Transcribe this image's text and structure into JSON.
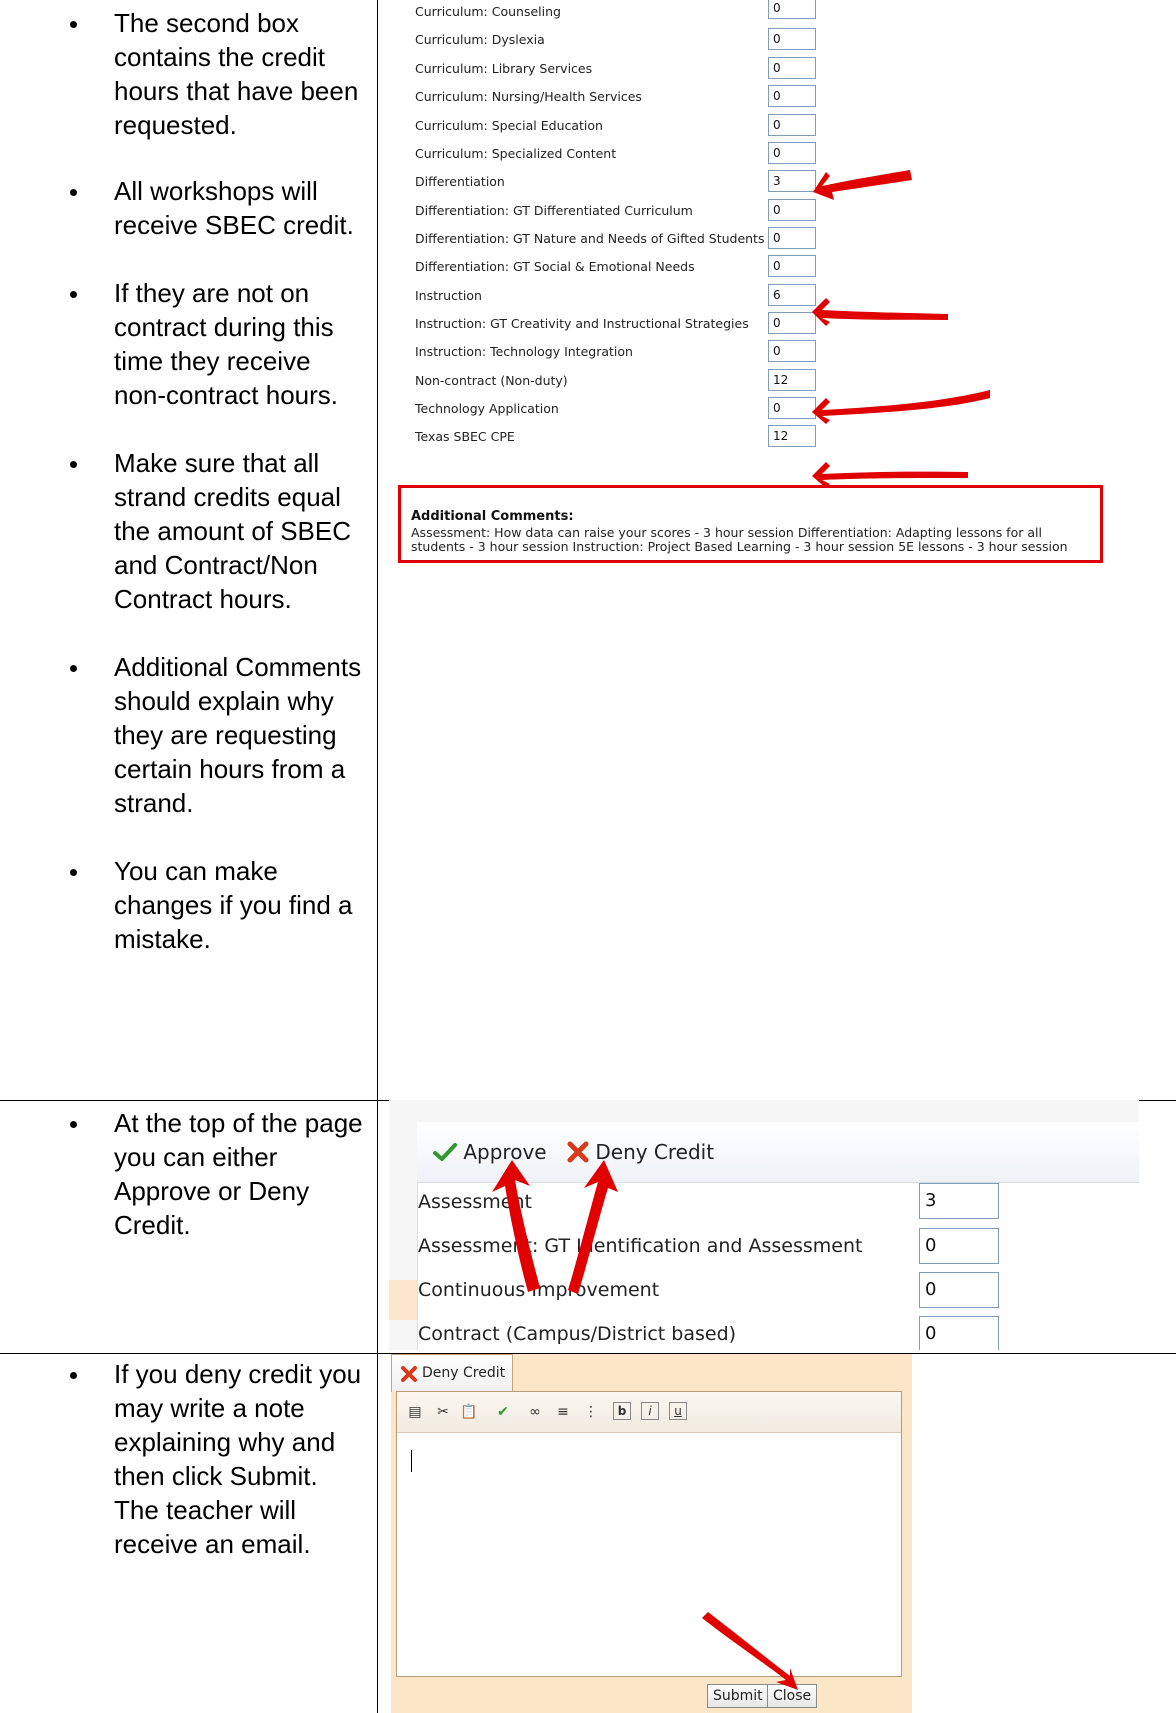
{
  "instructions": {
    "section1": [
      "The second box contains the credit hours that have been requested.",
      "All workshops will receive SBEC credit.",
      "If they are not on contract during this time they receive non-contract hours.",
      "Make sure that all strand credits equal the amount of SBEC and Contract/Non Contract hours.",
      "Additional Comments should explain why they are requesting certain hours from a strand.",
      "You can make changes if you find a mistake."
    ],
    "section2": [
      "At the top of the page you can either Approve or Deny Credit."
    ],
    "section3": [
      "If you deny credit you may write a note explaining why and then click Submit.  The teacher will receive an email."
    ]
  },
  "strands": {
    "rows": [
      {
        "label": "Curriculum: Counseling",
        "value": "0"
      },
      {
        "label": "Curriculum: Dyslexia",
        "value": "0"
      },
      {
        "label": "Curriculum: Library Services",
        "value": "0"
      },
      {
        "label": "Curriculum: Nursing/Health Services",
        "value": "0"
      },
      {
        "label": "Curriculum: Special Education",
        "value": "0"
      },
      {
        "label": "Curriculum: Specialized Content",
        "value": "0"
      },
      {
        "label": "Differentiation",
        "value": "3"
      },
      {
        "label": "Differentiation: GT Differentiated Curriculum",
        "value": "0"
      },
      {
        "label": "Differentiation: GT Nature and Needs of Gifted Students",
        "value": "0"
      },
      {
        "label": "Differentiation: GT Social & Emotional Needs",
        "value": "0"
      },
      {
        "label": "Instruction",
        "value": "6"
      },
      {
        "label": "Instruction: GT Creativity and Instructional Strategies",
        "value": "0"
      },
      {
        "label": "Instruction: Technology Integration",
        "value": "0"
      },
      {
        "label": "Non-contract (Non-duty)",
        "value": "12"
      },
      {
        "label": "Technology Application",
        "value": "0"
      },
      {
        "label": "Texas SBEC CPE",
        "value": "12"
      }
    ],
    "comments_title": "Additional Comments:",
    "comments_text": "Assessment: How data can raise your scores - 3 hour session Differentiation: Adapting lessons for all students - 3 hour session Instruction: Project Based Learning - 3 hour session 5E lessons - 3 hour session"
  },
  "approval": {
    "approve_label": "Approve",
    "deny_label": "Deny Credit",
    "rows": [
      {
        "label": "Assessment",
        "value": "3"
      },
      {
        "label": "Assessment: GT Identification and Assessment",
        "value": "0"
      },
      {
        "label": "Continuous Improvement",
        "value": "0"
      },
      {
        "label": "Contract (Campus/District based)",
        "value": "0"
      }
    ]
  },
  "deny_dialog": {
    "tab_label": "Deny Credit",
    "submit_label": "Submit",
    "close_label": "Close",
    "toolbar_icons": [
      "paste-word-icon",
      "cut-icon",
      "paste-icon",
      "spellcheck-icon",
      "link-icon",
      "ordered-list-icon",
      "unordered-list-icon",
      "bold-icon",
      "italic-icon",
      "underline-icon"
    ]
  },
  "colors": {
    "arrow": "#e00000",
    "approve_check": "#2e9a2e",
    "deny_x": "#d63a1a",
    "dialog_bg": "#fbe6c8"
  }
}
